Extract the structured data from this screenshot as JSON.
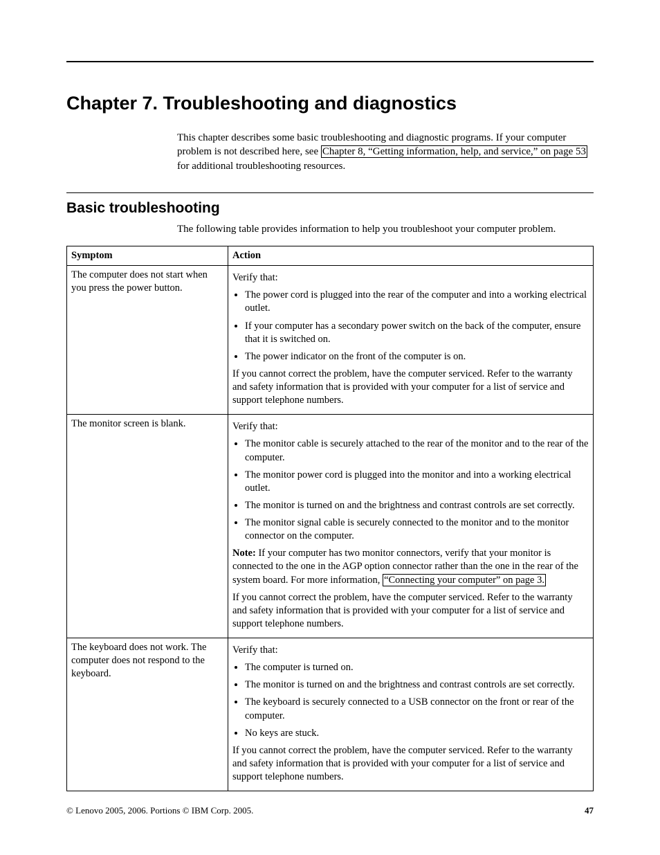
{
  "chapter_title": "Chapter 7. Troubleshooting and diagnostics",
  "intro": {
    "text_before": "This chapter describes some basic troubleshooting and diagnostic programs. If your computer problem is not described here, see ",
    "link": "Chapter 8, “Getting information, help, and service,” on page 53",
    "text_after": " for additional troubleshooting resources."
  },
  "section_title": "Basic troubleshooting",
  "section_intro": "The following table provides information to help you troubleshoot your computer problem.",
  "table": {
    "headers": {
      "symptom": "Symptom",
      "action": "Action"
    },
    "rows": [
      {
        "symptom": "The computer does not start when you press the power button.",
        "verify_label": "Verify that:",
        "bullets": [
          "The power cord is plugged into the rear of the computer and into a working electrical outlet.",
          "If your computer has a secondary power switch on the back of the computer, ensure that it is switched on.",
          "The power indicator on the front of the computer is on."
        ],
        "closing": "If you cannot correct the problem, have the computer serviced. Refer to the warranty and safety information that is provided with your computer for a list of service and support telephone numbers."
      },
      {
        "symptom": "The monitor screen is blank.",
        "verify_label": "Verify that:",
        "bullets": [
          "The monitor cable is securely attached to the rear of the monitor and to the rear of the computer.",
          "The monitor power cord is plugged into the monitor and into a working electrical outlet.",
          "The monitor is turned on and the brightness and contrast controls are set correctly.",
          "The monitor signal cable is securely connected to the monitor and to the monitor connector on the computer."
        ],
        "note_label": "Note:",
        "note_before": " If your computer has two monitor connectors, verify that your monitor is connected to the one in the AGP option connector rather than the one in the rear of the system board. For more information, ",
        "note_link": "“Connecting your computer” on page 3.",
        "closing": "If you cannot correct the problem, have the computer serviced. Refer to the warranty and safety information that is provided with your computer for a list of service and support telephone numbers."
      },
      {
        "symptom": "The keyboard does not work. The computer does not respond to the keyboard.",
        "verify_label": "Verify that:",
        "bullets": [
          "The computer is turned on.",
          "The monitor is turned on and the brightness and contrast controls are set correctly.",
          "The keyboard is securely connected to a USB connector on the front or rear of the computer.",
          "No keys are stuck."
        ],
        "closing": "If you cannot correct the problem, have the computer serviced. Refer to the warranty and safety information that is provided with your computer for a list of service and support telephone numbers."
      }
    ]
  },
  "footer": {
    "copyright": "© Lenovo 2005, 2006. Portions © IBM Corp. 2005.",
    "page_number": "47"
  }
}
